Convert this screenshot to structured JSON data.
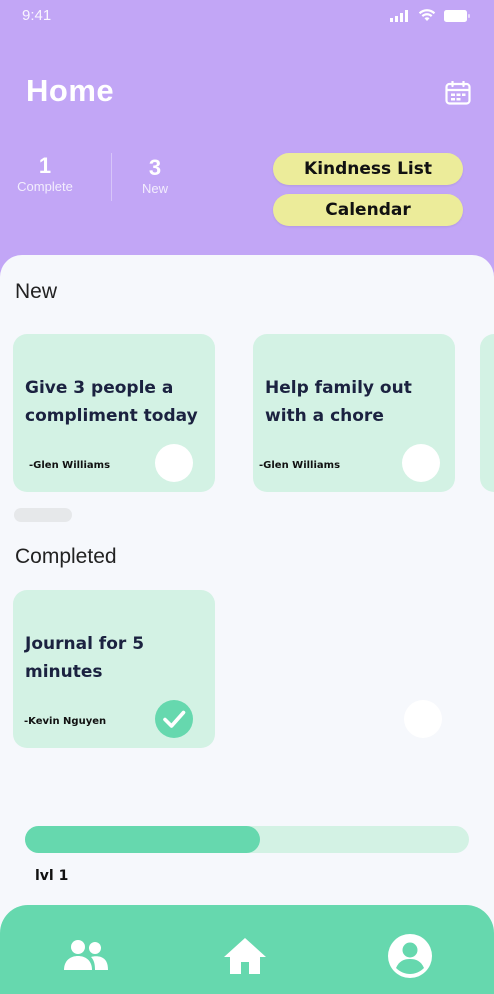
{
  "status_bar": {
    "time": "9:41"
  },
  "header": {
    "title": "Home",
    "stats": [
      {
        "value": "1",
        "label": "Complete"
      },
      {
        "value": "3",
        "label": "New"
      }
    ],
    "buttons": {
      "kindness_list": "Kindness List",
      "calendar": "Calendar"
    },
    "icons": {
      "calendar": "calendar-icon"
    }
  },
  "sections": {
    "new_title": "New",
    "completed_title": "Completed"
  },
  "new_cards": [
    {
      "text": "Give 3 people a compliment today",
      "author": "-Glen Williams",
      "done": false
    },
    {
      "text": "Help family out with a chore",
      "author": "-Glen Williams",
      "done": false
    }
  ],
  "completed_cards": [
    {
      "text": "Journal for 5 minutes",
      "author": "-Kevin Nguyen",
      "done": true
    }
  ],
  "progress": {
    "level_label": "lvl 1",
    "fraction": 0.53
  },
  "nav": {
    "items": [
      "friends-icon",
      "home-icon",
      "profile-icon"
    ]
  },
  "colors": {
    "header": "#c2a6f6",
    "card": "#d3f2e4",
    "accent": "#66d8ae",
    "pill": "#ecec9a"
  }
}
